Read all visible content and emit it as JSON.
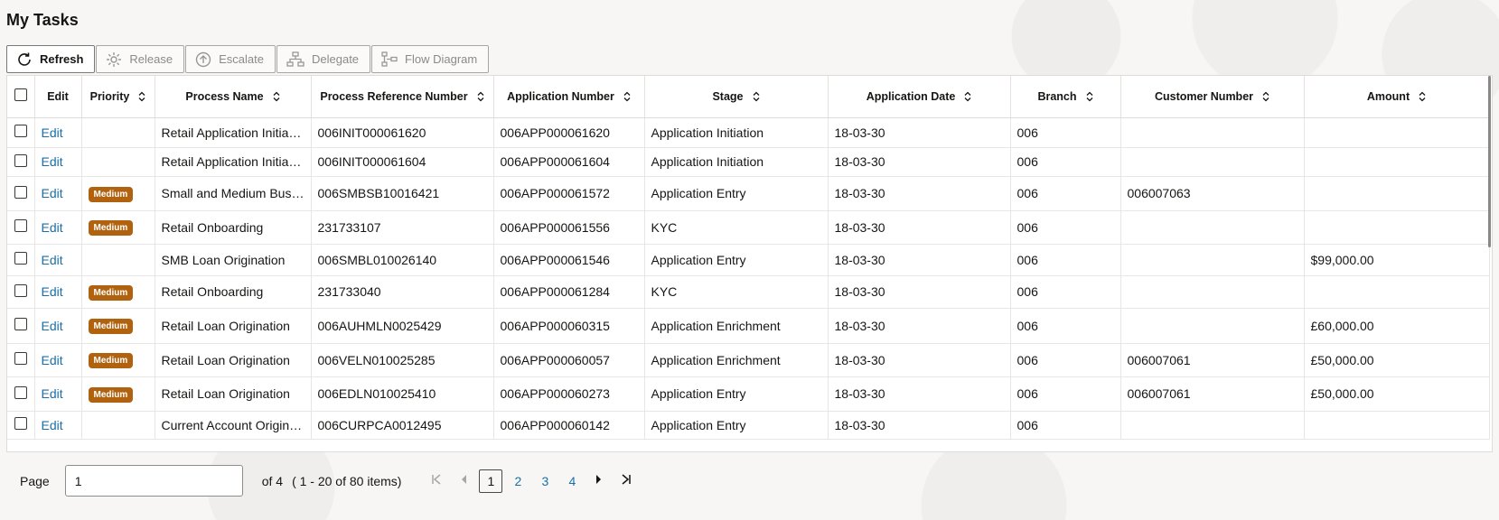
{
  "page": {
    "title": "My Tasks"
  },
  "toolbar": {
    "refresh": "Refresh",
    "release": "Release",
    "escalate": "Escalate",
    "delegate": "Delegate",
    "flow_diagram": "Flow Diagram"
  },
  "columns": {
    "edit": "Edit",
    "priority": "Priority",
    "process_name": "Process Name",
    "process_ref": "Process Reference Number",
    "app_number": "Application Number",
    "stage": "Stage",
    "app_date": "Application Date",
    "branch": "Branch",
    "customer_number": "Customer Number",
    "amount": "Amount"
  },
  "rows": [
    {
      "edit": "Edit",
      "priority": "",
      "process_name": "Retail Application Initiation",
      "process_ref": "006INIT000061620",
      "app_number": "006APP000061620",
      "stage": "Application Initiation",
      "app_date": "18-03-30",
      "branch": "006",
      "customer_number": "",
      "amount": ""
    },
    {
      "edit": "Edit",
      "priority": "",
      "process_name": "Retail Application Initiation",
      "process_ref": "006INIT000061604",
      "app_number": "006APP000061604",
      "stage": "Application Initiation",
      "app_date": "18-03-30",
      "branch": "006",
      "customer_number": "",
      "amount": ""
    },
    {
      "edit": "Edit",
      "priority": "Medium",
      "process_name": "Small and Medium Business",
      "process_ref": "006SMBSB10016421",
      "app_number": "006APP000061572",
      "stage": "Application Entry",
      "app_date": "18-03-30",
      "branch": "006",
      "customer_number": "006007063",
      "amount": ""
    },
    {
      "edit": "Edit",
      "priority": "Medium",
      "process_name": "Retail Onboarding",
      "process_ref": "231733107",
      "app_number": "006APP000061556",
      "stage": "KYC",
      "app_date": "18-03-30",
      "branch": "006",
      "customer_number": "",
      "amount": ""
    },
    {
      "edit": "Edit",
      "priority": "",
      "process_name": "SMB Loan Origination",
      "process_ref": "006SMBL010026140",
      "app_number": "006APP000061546",
      "stage": "Application Entry",
      "app_date": "18-03-30",
      "branch": "006",
      "customer_number": "",
      "amount": "$99,000.00"
    },
    {
      "edit": "Edit",
      "priority": "Medium",
      "process_name": "Retail Onboarding",
      "process_ref": "231733040",
      "app_number": "006APP000061284",
      "stage": "KYC",
      "app_date": "18-03-30",
      "branch": "006",
      "customer_number": "",
      "amount": ""
    },
    {
      "edit": "Edit",
      "priority": "Medium",
      "process_name": "Retail Loan Origination",
      "process_ref": "006AUHMLN0025429",
      "app_number": "006APP000060315",
      "stage": "Application Enrichment",
      "app_date": "18-03-30",
      "branch": "006",
      "customer_number": "",
      "amount": "£60,000.00"
    },
    {
      "edit": "Edit",
      "priority": "Medium",
      "process_name": "Retail Loan Origination",
      "process_ref": "006VELN010025285",
      "app_number": "006APP000060057",
      "stage": "Application Enrichment",
      "app_date": "18-03-30",
      "branch": "006",
      "customer_number": "006007061",
      "amount": "£50,000.00"
    },
    {
      "edit": "Edit",
      "priority": "Medium",
      "process_name": "Retail Loan Origination",
      "process_ref": "006EDLN010025410",
      "app_number": "006APP000060273",
      "stage": "Application Entry",
      "app_date": "18-03-30",
      "branch": "006",
      "customer_number": "006007061",
      "amount": "£50,000.00"
    },
    {
      "edit": "Edit",
      "priority": "",
      "process_name": "Current Account Origination",
      "process_ref": "006CURPCA0012495",
      "app_number": "006APP000060142",
      "stage": "Application Entry",
      "app_date": "18-03-30",
      "branch": "006",
      "customer_number": "",
      "amount": ""
    }
  ],
  "pager": {
    "label": "Page",
    "current": "1",
    "of_text": "of 4",
    "range_text": "( 1 - 20 of 80 items)",
    "pages": [
      "1",
      "2",
      "3",
      "4"
    ]
  },
  "colors": {
    "badge": "#b1620f",
    "link": "#1a6fa8"
  }
}
